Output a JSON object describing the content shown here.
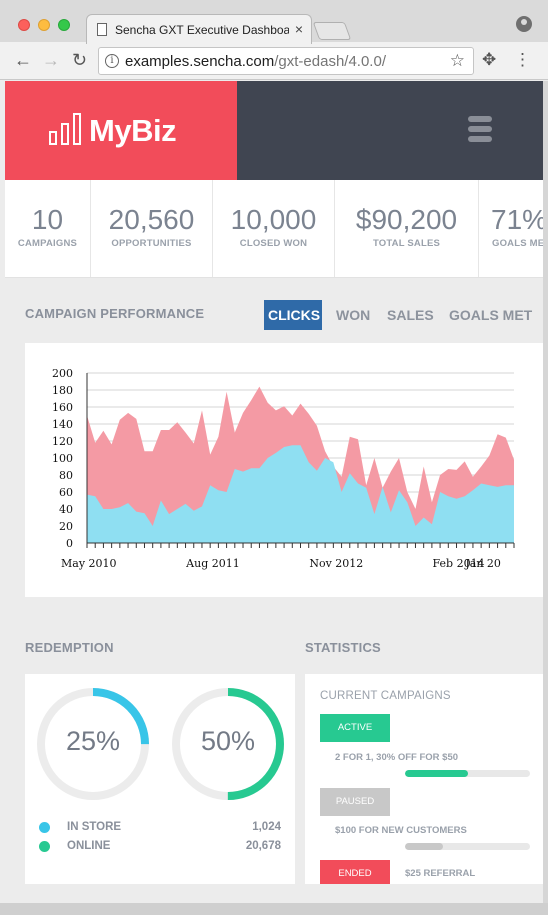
{
  "browser": {
    "tab_title": "Sencha GXT Executive Dashboard",
    "tab_close": "×",
    "url_host": "examples.sencha.com",
    "url_path": "/gxt-edash/4.0.0/",
    "back_glyph": "←",
    "forward_glyph": "→",
    "reload_glyph": "↻",
    "star_glyph": "☆",
    "ext_glyph": "✥",
    "menu_glyph": "⋮",
    "info_glyph": "i"
  },
  "header": {
    "brand_name": "MyBiz",
    "brand_color": "#f24c5a",
    "dark_color": "#404551"
  },
  "kpis": [
    {
      "value": "10",
      "label": "CAMPAIGNS"
    },
    {
      "value": "20,560",
      "label": "OPPORTUNITIES"
    },
    {
      "value": "10,000",
      "label": "CLOSED WON"
    },
    {
      "value": "$90,200",
      "label": "TOTAL SALES"
    },
    {
      "value": "71%",
      "label": "GOALS MET"
    }
  ],
  "performance": {
    "title": "CAMPAIGN PERFORMANCE",
    "tabs": [
      "CLICKS",
      "WON",
      "SALES",
      "GOALS MET"
    ],
    "active_tab": "CLICKS",
    "active_color": "#2f6aa8"
  },
  "chart_data": {
    "type": "area",
    "ylim": [
      0,
      200
    ],
    "yticks": [
      "0",
      "20",
      "40",
      "60",
      "80",
      "100",
      "120",
      "140",
      "160",
      "180",
      "200"
    ],
    "xlabels": [
      "May 2010",
      "Aug 2011",
      "Nov 2012",
      "Feb 2014",
      "Jan 20"
    ],
    "grid": true,
    "series": [
      {
        "color": "#f49aa4",
        "values": [
          150,
          118,
          132,
          116,
          145,
          153,
          146,
          108,
          108,
          133,
          133,
          142,
          130,
          117,
          156,
          104,
          125,
          178,
          130,
          153,
          168,
          184,
          165,
          156,
          161,
          150,
          164,
          152,
          138,
          108,
          90,
          78,
          125,
          122,
          68,
          100,
          65,
          84,
          100,
          60,
          40,
          90,
          48,
          80,
          87,
          86,
          96,
          78,
          90,
          103,
          128,
          124,
          98
        ]
      },
      {
        "color": "#8fdff2",
        "values": [
          57,
          55,
          40,
          40,
          42,
          47,
          37,
          35,
          20,
          50,
          34,
          40,
          46,
          38,
          43,
          68,
          62,
          60,
          87,
          84,
          88,
          88,
          100,
          106,
          113,
          115,
          115,
          95,
          85,
          100,
          95,
          60,
          82,
          70,
          65,
          34,
          66,
          36,
          62,
          48,
          20,
          30,
          22,
          60,
          55,
          52,
          55,
          62,
          70,
          68,
          66,
          68,
          68
        ]
      }
    ]
  },
  "redemption": {
    "title": "REDEMPTION",
    "donuts": [
      {
        "pct": 25,
        "label": "25%",
        "color": "#38c5e8"
      },
      {
        "pct": 50,
        "label": "50%",
        "color": "#27c991"
      }
    ],
    "legend": [
      {
        "label": "IN STORE",
        "value": "1,024",
        "color": "#38c5e8"
      },
      {
        "label": "ONLINE",
        "value": "20,678",
        "color": "#27c991"
      }
    ]
  },
  "statistics": {
    "title": "STATISTICS",
    "subtitle": "CURRENT CAMPAIGNS",
    "campaigns": [
      {
        "status": "ACTIVE",
        "status_color": "#27c991",
        "name": "2 FOR 1, 30% OFF FOR $50",
        "progress": 0.5,
        "bar_color": "#27c991"
      },
      {
        "status": "PAUSED",
        "status_color": "#c8c8c8",
        "name": "$100 FOR NEW CUSTOMERS",
        "progress": 0.3,
        "bar_color": "#c8c8c8"
      },
      {
        "status": "ENDED",
        "status_color": "#f24c5a",
        "name": "$25 REFERRAL",
        "progress": null,
        "bar_color": "#f24c5a"
      }
    ]
  }
}
